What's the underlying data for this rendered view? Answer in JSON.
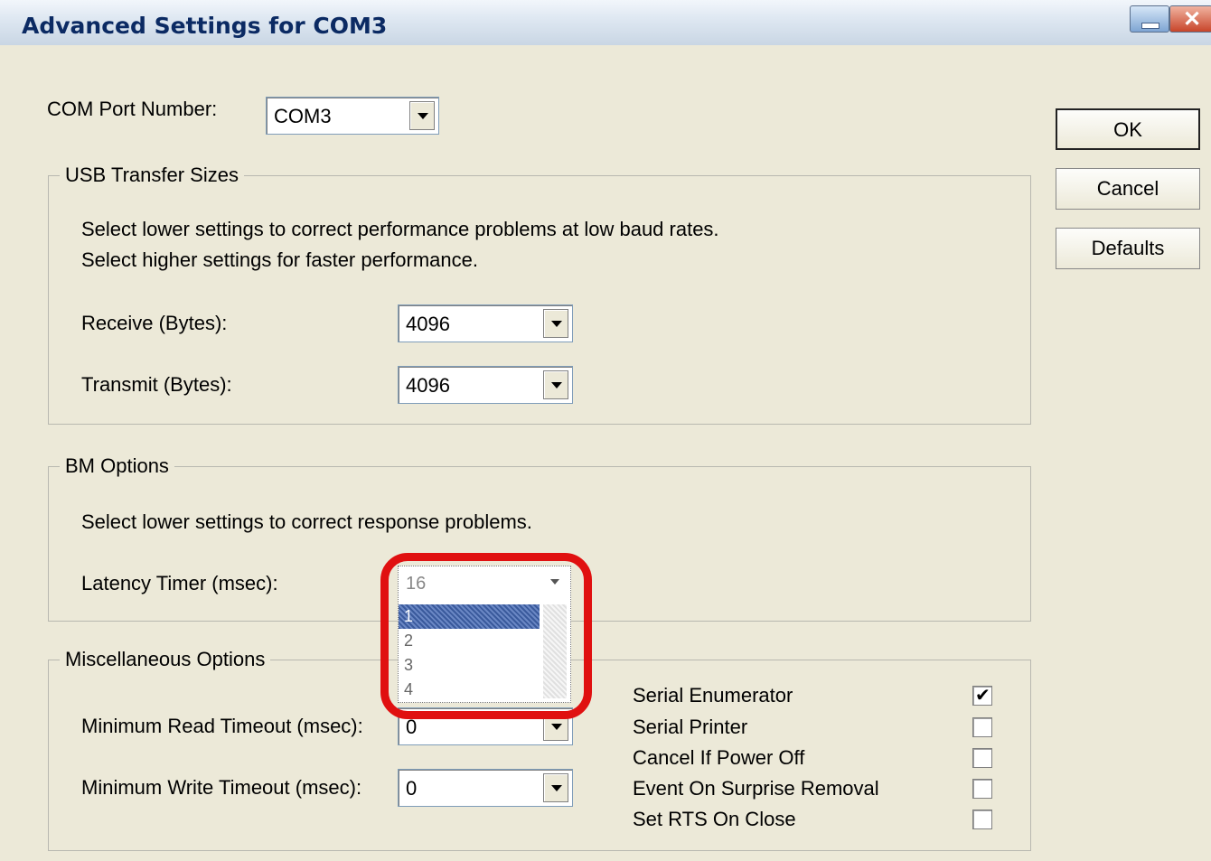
{
  "window": {
    "title": "Advanced Settings for COM3"
  },
  "com_port": {
    "label": "COM Port Number:",
    "value": "COM3"
  },
  "buttons": {
    "ok": "OK",
    "cancel": "Cancel",
    "defaults": "Defaults"
  },
  "usb_transfer": {
    "legend": "USB Transfer Sizes",
    "line1": "Select lower settings to correct performance problems at low baud rates.",
    "line2": "Select higher settings for faster performance.",
    "receive_label": "Receive (Bytes):",
    "receive_value": "4096",
    "transmit_label": "Transmit (Bytes):",
    "transmit_value": "4096"
  },
  "bm_options": {
    "legend": "BM Options",
    "line1": "Select lower settings to correct response problems.",
    "latency_label": "Latency Timer (msec):",
    "latency_value": "16",
    "latency_options": [
      "1",
      "2",
      "3",
      "4"
    ]
  },
  "misc": {
    "legend": "Miscellaneous Options",
    "read_timeout_label": "Minimum Read Timeout (msec):",
    "read_timeout_value": "0",
    "write_timeout_label": "Minimum Write Timeout (msec):",
    "write_timeout_value": "0",
    "checks": [
      {
        "label": "Serial Enumerator",
        "checked": true
      },
      {
        "label": "Serial Printer",
        "checked": false
      },
      {
        "label": "Cancel If Power Off",
        "checked": false
      },
      {
        "label": "Event On Surprise Removal",
        "checked": false
      },
      {
        "label": "Set RTS On Close",
        "checked": false
      }
    ]
  }
}
